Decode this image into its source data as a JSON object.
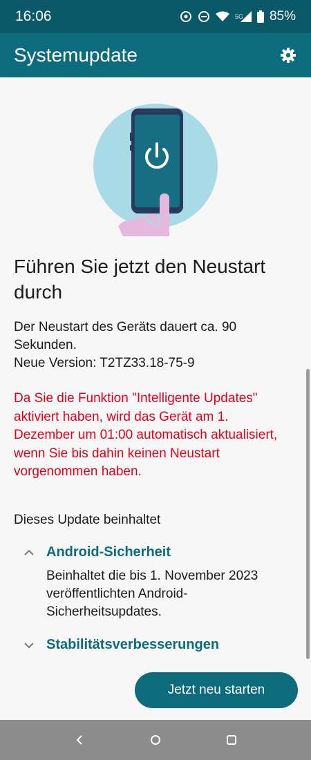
{
  "status_bar": {
    "time": "16:06",
    "network": "5G",
    "battery": "85%",
    "icons": [
      "sync-icon",
      "dnd-icon",
      "wifi-icon",
      "signal-icon",
      "battery-icon"
    ]
  },
  "app_bar": {
    "title": "Systemupdate",
    "settings_icon": "gear-icon"
  },
  "main": {
    "heading": "Führen Sie jetzt den Neustart durch",
    "info_line1": "Der Neustart des Geräts dauert ca. 90 Sekunden.",
    "info_line2": "Neue Version: T2TZ33.18-75-9",
    "warning": "Da Sie die Funktion \"Intelligente Updates\" aktiviert haben, wird das Gerät am 1. Dezember um 01:00 automatisch aktualisiert, wenn Sie bis dahin keinen Neustart vorgenommen haben.",
    "includes_label": "Dieses Update beinhaltet",
    "sections": [
      {
        "title": "Android-Sicherheit",
        "expanded": true,
        "body": "Beinhaltet die bis 1. November 2023 veröffentlichten Android-Sicherheitsupdates."
      },
      {
        "title": "Stabilitätsverbesserungen",
        "expanded": false,
        "body": ""
      }
    ]
  },
  "restart_button": {
    "label": "Jetzt neu starten"
  },
  "nav_bar": {
    "icons": [
      "back-icon",
      "home-icon",
      "recents-icon"
    ]
  },
  "colors": {
    "status_bar": "#0a5868",
    "app_bar": "#0d6b7e",
    "accent": "#0d6b7e",
    "warning": "#e3001b",
    "nav_bar": "#8c8c8c"
  }
}
